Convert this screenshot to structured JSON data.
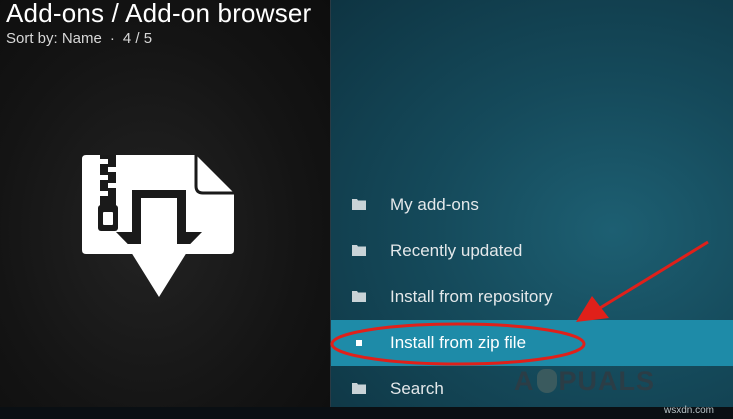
{
  "header": {
    "title": "Add-ons / Add-on browser",
    "sort_label": "Sort by: Name",
    "separator": "·",
    "position": "4 / 5"
  },
  "hero": {
    "icon": "zip-download-icon"
  },
  "menu": {
    "items": [
      {
        "label": "My add-ons",
        "icon": "folder-icon"
      },
      {
        "label": "Recently updated",
        "icon": "folder-icon"
      },
      {
        "label": "Install from repository",
        "icon": "folder-icon"
      },
      {
        "label": "Install from zip file",
        "icon": "square-bullet-icon",
        "focused": true
      },
      {
        "label": "Search",
        "icon": "folder-icon"
      }
    ]
  },
  "annotation": {
    "color": "#e0201a",
    "icons": [
      "red-circle-highlight",
      "red-arrow-icon"
    ]
  },
  "watermark": {
    "text_left": "A",
    "text_right": "PUALS"
  },
  "site_tag": "wsxdn.com",
  "colors": {
    "left_bg": "#141414",
    "right_bg": "#154a5b",
    "focus_bg": "#1e8ba8",
    "text": "#ffffff"
  }
}
